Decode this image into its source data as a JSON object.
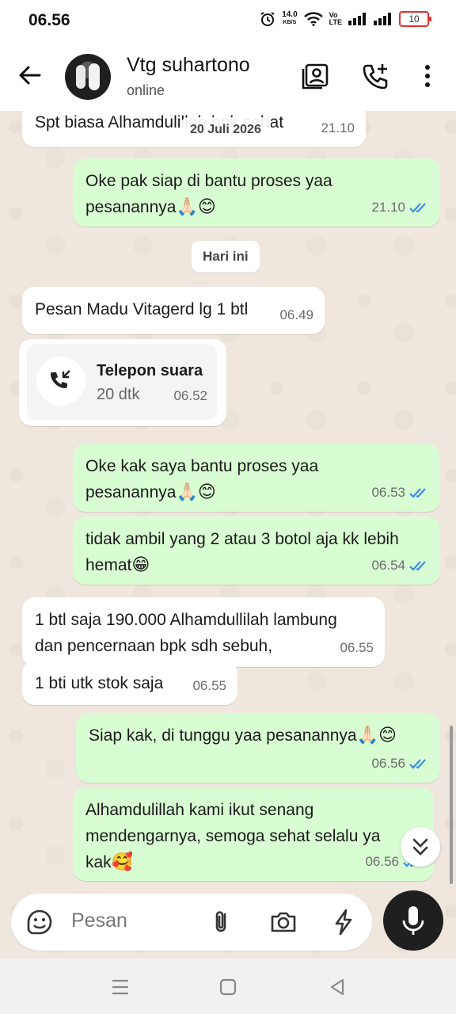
{
  "status_bar": {
    "time": "06.56",
    "net_speed_value": "14.0",
    "net_speed_unit": "KB/S",
    "volte_top": "Vo",
    "volte_bottom": "LTE",
    "battery": "10"
  },
  "header": {
    "contact_name": "Vtg suhartono",
    "presence": "online"
  },
  "chat": {
    "date_chip": "20 Juli 2026",
    "day_chip": "Hari ini",
    "messages": [
      {
        "direction": "in",
        "text": "Spt biasa Alhamdulillah bpk sehat",
        "time": "21.10"
      },
      {
        "direction": "out",
        "text_line1": "Oke pak siap di bantu proses yaa",
        "text_line2": "pesanannya",
        "emoji": "🙏🏻😊",
        "time": "21.10",
        "status": "read"
      },
      {
        "direction": "in",
        "text": "Pesan Madu Vitagerd lg 1 btl",
        "time": "06.49"
      },
      {
        "direction": "out",
        "text_line1": "Oke kak saya bantu proses yaa",
        "text_line2": "pesanannya",
        "emoji": "🙏🏻😊",
        "time": "06.53",
        "status": "read"
      },
      {
        "direction": "out",
        "text_line1": "tidak ambil yang 2 atau 3 botol aja kk lebih",
        "text_line2": "hemat",
        "emoji": "😁",
        "time": "06.54",
        "status": "read"
      },
      {
        "direction": "in",
        "text_line1": "1 btl saja 190.000 Alhamdullilah lambung",
        "text_line2": "dan pencernaan bpk sdh sebuh,",
        "time": "06.55"
      },
      {
        "direction": "in",
        "text": "1 bti utk stok saja",
        "time": "06.55"
      },
      {
        "direction": "out",
        "text": "Siap kak, di tunggu yaa pesanannya",
        "emoji": "🙏🏻😊",
        "time": "06.56",
        "status": "read"
      },
      {
        "direction": "out",
        "text_line1": "Alhamdulillah kami ikut senang",
        "text_line2": "mendengarnya, semoga sehat selalu ya",
        "text_line3": "kak",
        "emoji": "🥰",
        "time": "06.56",
        "status": "read"
      }
    ],
    "call": {
      "title": "Telepon suara",
      "duration": "20 dtk",
      "time": "06.52"
    }
  },
  "input": {
    "placeholder": "Pesan"
  },
  "colors": {
    "outgoing_bubble": "#d9fdd3",
    "incoming_bubble": "#ffffff",
    "read_tick": "#3b8ee8",
    "wallpaper": "#efe7de",
    "mic_button": "#1f1f1f"
  },
  "icons": [
    "back-arrow-icon",
    "contact-card-icon",
    "add-call-icon",
    "more-vert-icon",
    "missed-call-icon",
    "sticker-icon",
    "attach-icon",
    "camera-icon",
    "quick-reply-icon",
    "mic-icon",
    "scroll-down-icon",
    "menu-nav-icon",
    "home-nav-icon",
    "back-nav-icon"
  ]
}
